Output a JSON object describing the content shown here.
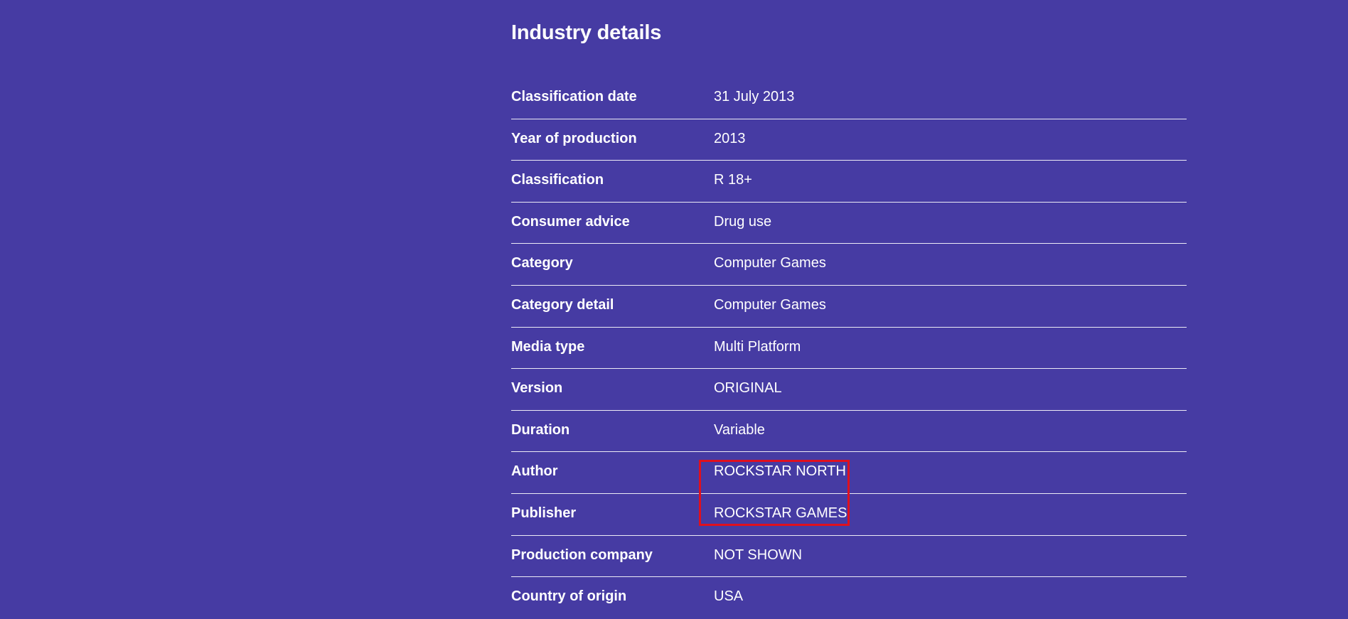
{
  "section": {
    "title": "Industry details"
  },
  "details": {
    "rows": [
      {
        "label": "Classification date",
        "value": "31 July 2013"
      },
      {
        "label": "Year of production",
        "value": "2013"
      },
      {
        "label": "Classification",
        "value": "R 18+"
      },
      {
        "label": "Consumer advice",
        "value": "Drug use"
      },
      {
        "label": "Category",
        "value": "Computer Games"
      },
      {
        "label": "Category detail",
        "value": "Computer Games"
      },
      {
        "label": "Media type",
        "value": "Multi Platform"
      },
      {
        "label": "Version",
        "value": "ORIGINAL"
      },
      {
        "label": "Duration",
        "value": "Variable"
      },
      {
        "label": "Author",
        "value": "ROCKSTAR NORTH"
      },
      {
        "label": "Publisher",
        "value": "ROCKSTAR GAMES"
      },
      {
        "label": "Production company",
        "value": "NOT SHOWN"
      },
      {
        "label": "Country of origin",
        "value": "USA"
      }
    ]
  },
  "colors": {
    "background": "#463ba3",
    "text": "#ffffff",
    "highlight": "#e0101e"
  }
}
